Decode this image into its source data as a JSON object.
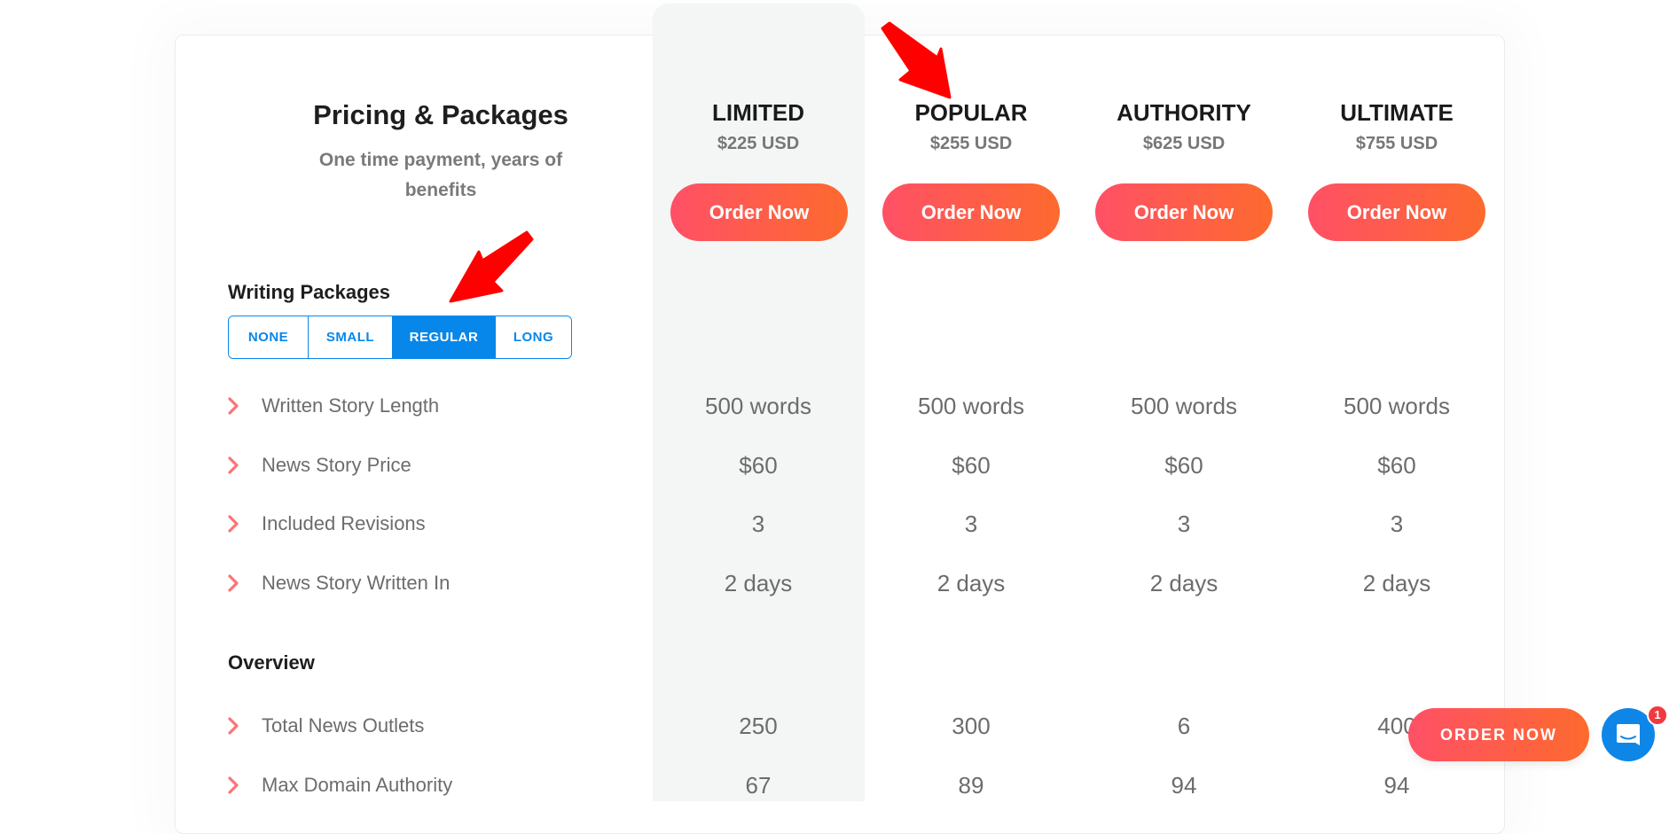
{
  "header": {
    "title": "Pricing & Packages",
    "subtitle": "One time payment, years of benefits"
  },
  "plans": [
    {
      "name": "LIMITED",
      "price": "$225 USD",
      "button": "Order Now",
      "highlighted": true
    },
    {
      "name": "POPULAR",
      "price": "$255 USD",
      "button": "Order Now",
      "highlighted": false
    },
    {
      "name": "AUTHORITY",
      "price": "$625 USD",
      "button": "Order Now",
      "highlighted": false
    },
    {
      "name": "ULTIMATE",
      "price": "$755 USD",
      "button": "Order Now",
      "highlighted": false
    }
  ],
  "writing_packages": {
    "title": "Writing Packages",
    "options": [
      "NONE",
      "SMALL",
      "REGULAR",
      "LONG"
    ],
    "selected": "REGULAR",
    "rows": [
      {
        "label": "Written Story Length",
        "values": [
          "500 words",
          "500 words",
          "500 words",
          "500 words"
        ]
      },
      {
        "label": "News Story Price",
        "values": [
          "$60",
          "$60",
          "$60",
          "$60"
        ]
      },
      {
        "label": "Included Revisions",
        "values": [
          "3",
          "3",
          "3",
          "3"
        ]
      },
      {
        "label": "News Story Written In",
        "values": [
          "2 days",
          "2 days",
          "2 days",
          "2 days"
        ]
      }
    ]
  },
  "overview": {
    "title": "Overview",
    "rows": [
      {
        "label": "Total News Outlets",
        "values": [
          "250",
          "300",
          "6",
          "400"
        ]
      },
      {
        "label": "Max Domain Authority",
        "values": [
          "67",
          "89",
          "94",
          "94"
        ]
      }
    ]
  },
  "floating": {
    "order_label": "ORDER NOW",
    "chat_badge": "1"
  },
  "colors": {
    "accent_blue": "#0787ea",
    "gradient_start": "#ff5066",
    "gradient_end": "#fd6a2e",
    "annotation_red": "#ff0000",
    "highlight_column": "#f3f6f5"
  },
  "icons": {
    "feature_bullet": "chevron-right-icon",
    "chat": "chat-icon",
    "annotation": "arrow-icon"
  }
}
